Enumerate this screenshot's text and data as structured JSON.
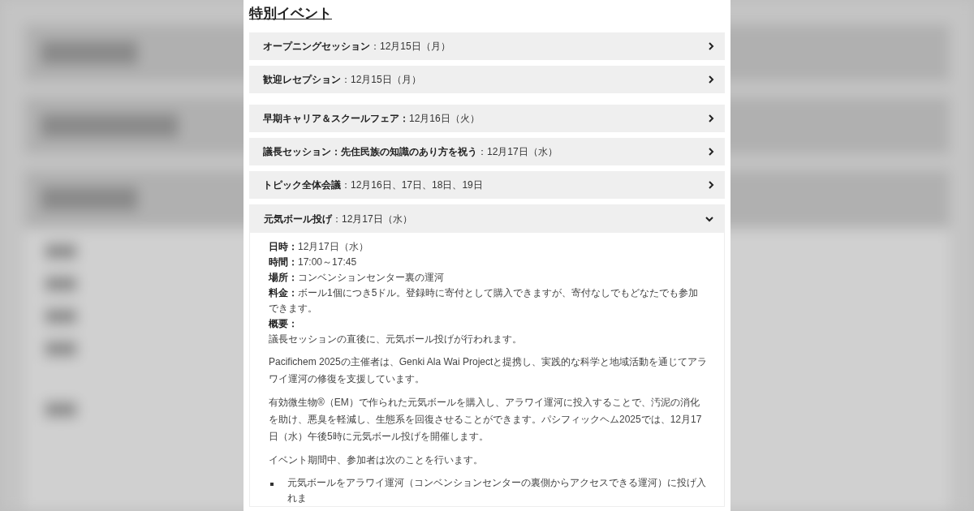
{
  "heading": "特別イベント",
  "groups": [
    {
      "items": [
        {
          "title": "オープニングセッション",
          "date": "：12月15日（月）",
          "expanded": false
        },
        {
          "title": "歓迎レセプション",
          "date": "：12月15日（月）",
          "expanded": false
        }
      ]
    },
    {
      "items": [
        {
          "title": "早期キャリア＆スクールフェア：",
          "date": "12月16日（火）",
          "expanded": false
        },
        {
          "title": "議長セッション：先住民族の知識のあり方を祝う",
          "date": "：12月17日（水）",
          "expanded": false
        },
        {
          "title": "トピック全体会議",
          "date": "：12月16日、17日、18日、19日",
          "expanded": false
        },
        {
          "title": "元気ボール投げ",
          "date": "：12月17日（水）",
          "expanded": true,
          "details": {
            "fields": [
              {
                "label": "日時：",
                "value": "12月17日（水）"
              },
              {
                "label": "時間：",
                "value": "17:00～17:45"
              },
              {
                "label": "場所：",
                "value": "コンベンションセンター裏の運河"
              },
              {
                "label": "料金：",
                "value": "ボール1個につき5ドル。登録時に寄付として購入できますが、寄付なしでもどなたでも参加できます。"
              },
              {
                "label": "概要："
              }
            ],
            "summary": "議長セッションの直後に、元気ボール投げが行われます。",
            "paragraphs": [
              "Pacifichem 2025の主催者は、Genki Ala Wai Projectと提携し、実践的な科学と地域活動を通じてアラワイ運河の修復を支援しています。",
              "有効微生物®（EM）で作られた元気ボールを購入し、アラワイ運河に投入することで、汚泥の消化を助け、悪臭を軽減し、生態系を回復させることができます。パシフィックヘム2025では、12月17日（水）午後5時に元気ボール投げを開催します。",
              "イベント期間中、参加者は次のことを行います。"
            ],
            "bullets": [
              "元気ボールをアラワイ運河（コンベンションセンターの裏側からアクセスできる運河）に投げ入れま"
            ]
          }
        }
      ]
    }
  ]
}
